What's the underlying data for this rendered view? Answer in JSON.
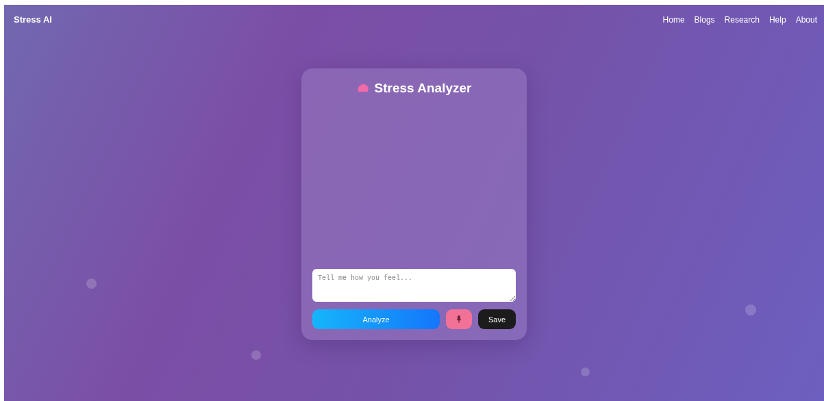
{
  "brand": "Stress AI",
  "nav": [
    {
      "label": "Home"
    },
    {
      "label": "Blogs"
    },
    {
      "label": "Research"
    },
    {
      "label": "Help"
    },
    {
      "label": "About"
    }
  ],
  "card": {
    "title": "Stress Analyzer",
    "input": {
      "placeholder": "Tell me how you feel..."
    },
    "buttons": [
      {
        "kind": "primary",
        "label": "Analyze"
      },
      {
        "kind": "mic"
      },
      {
        "kind": "dark",
        "label": "Save"
      }
    ]
  }
}
